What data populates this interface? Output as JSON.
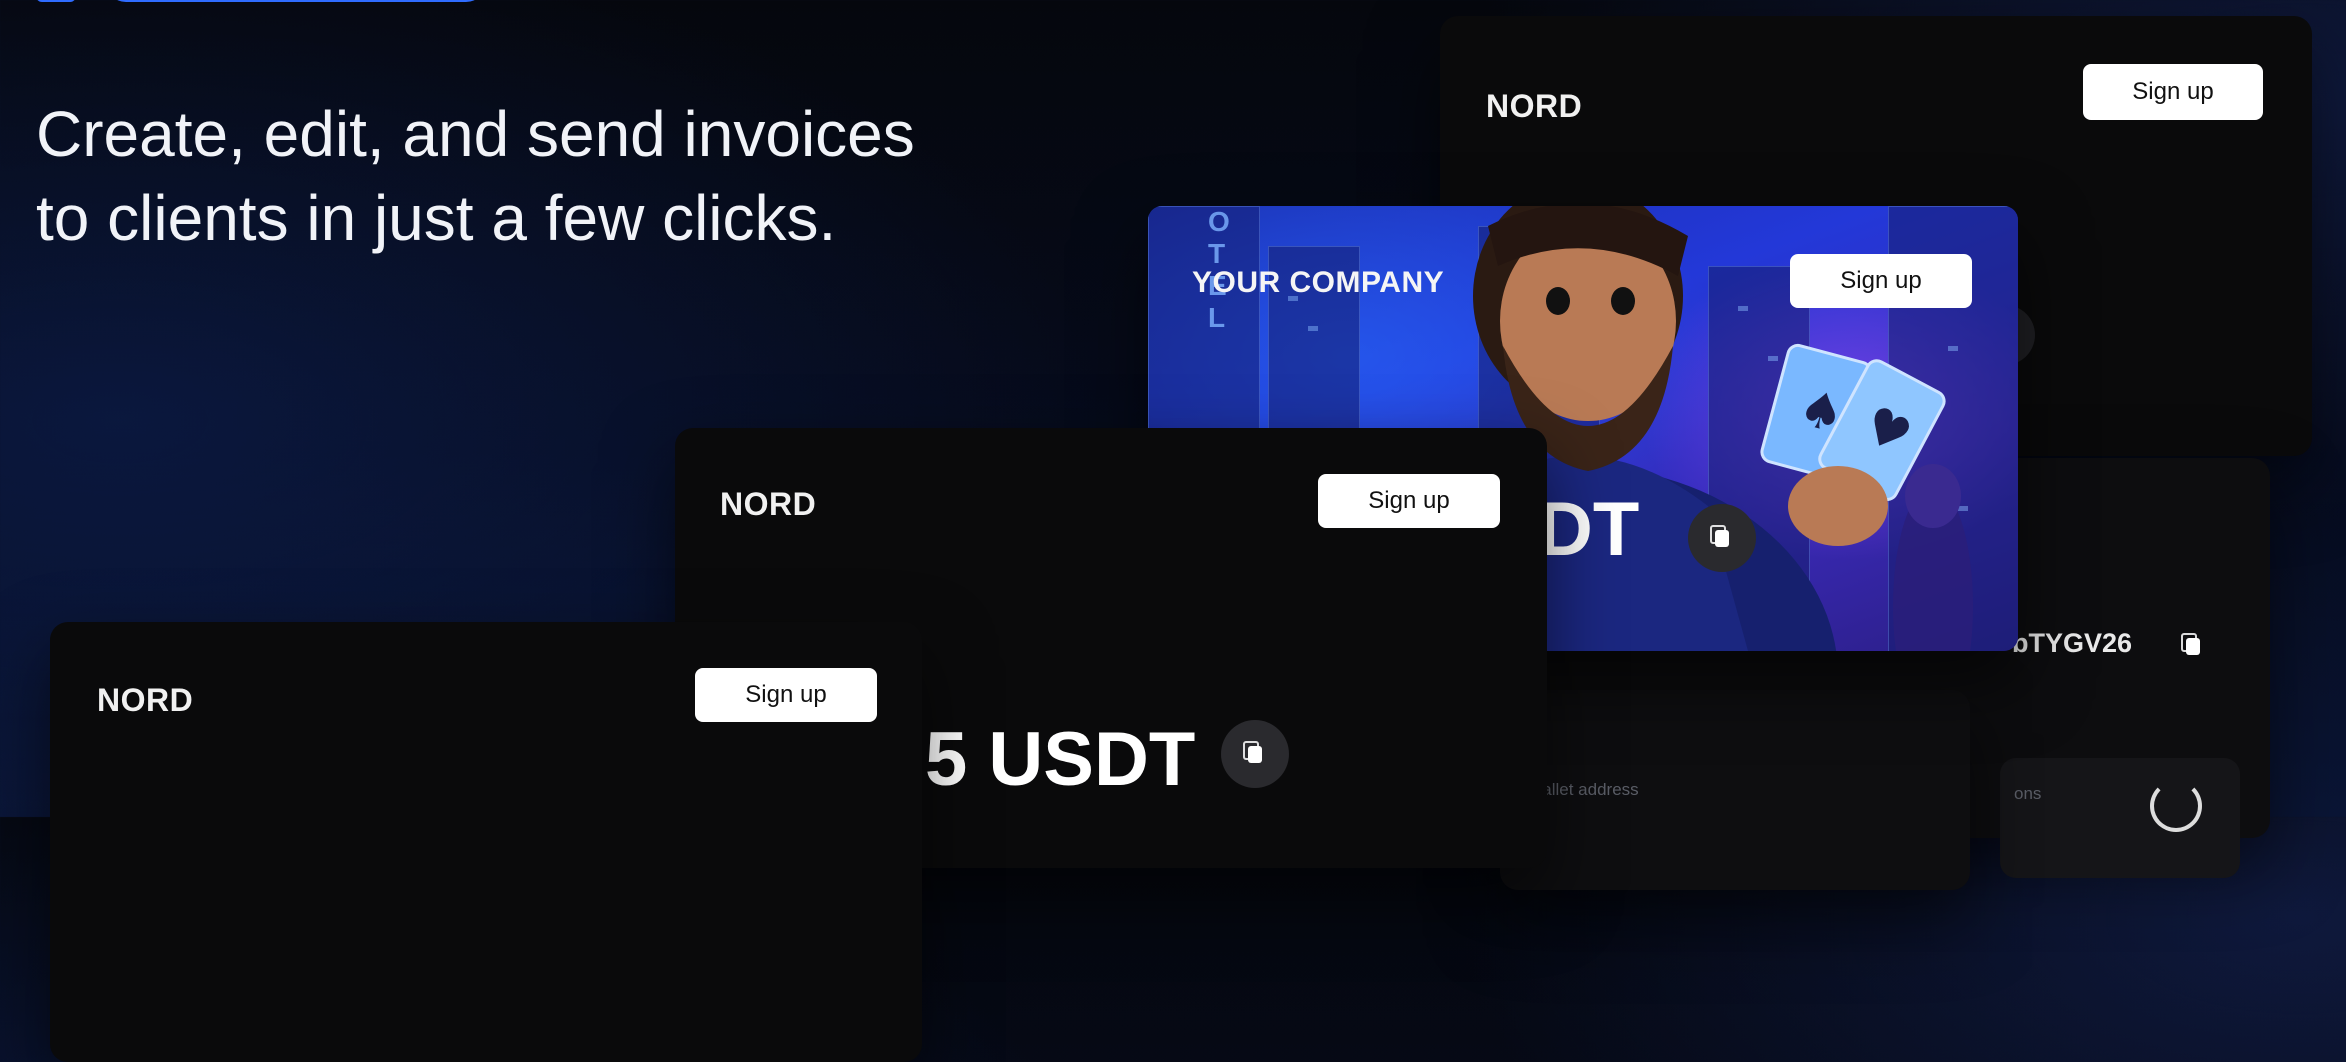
{
  "hero": {
    "subtitle_line1": "Create, edit, and send invoices",
    "subtitle_line2": "to clients in just a few clicks."
  },
  "colors": {
    "accent": "#2f6cff",
    "card_bg": "#0a0a0b",
    "button_bg": "#ffffff"
  },
  "cards": {
    "back_right": {
      "logo": "NORD",
      "signup_label": "Sign up",
      "address_fragment": "bTYGV26"
    },
    "illustration": {
      "company": "YOUR COMPANY",
      "signup_label": "Sign up",
      "amount_fragment": "DT",
      "sign_letters": [
        "O",
        "T",
        "E",
        "L"
      ]
    },
    "middle": {
      "logo": "NORD",
      "signup_label": "Sign up",
      "amount": "5 USDT"
    },
    "front_left": {
      "logo": "NORD",
      "signup_label": "Sign up"
    },
    "lower_right": {
      "wallet_label": "wallet address",
      "options_fragment": "ons"
    }
  }
}
